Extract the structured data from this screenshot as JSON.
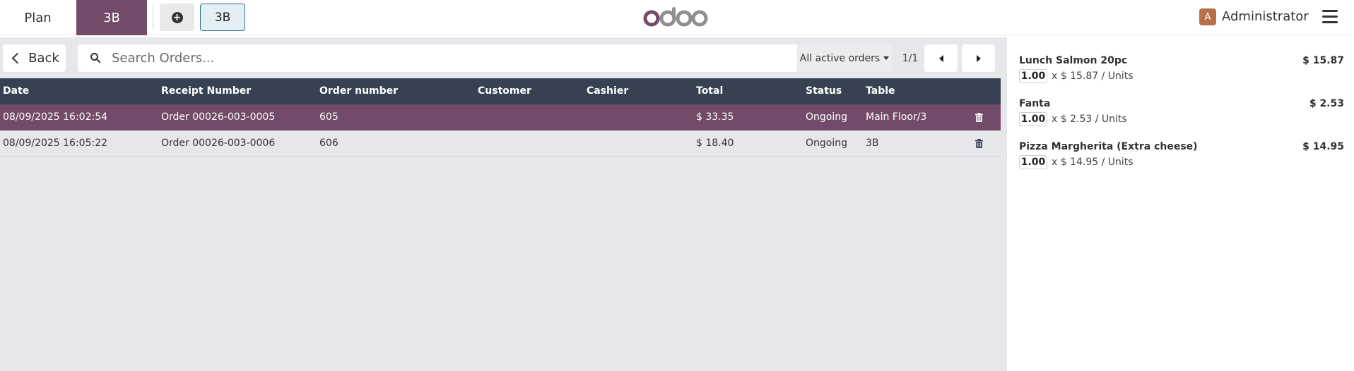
{
  "topbar": {
    "plan_label": "Plan",
    "active_table_label": "3B",
    "table_chip_label": "3B",
    "brand": "odoo",
    "user_initial": "A",
    "user_name": "Administrator",
    "accent_color": "#714b67"
  },
  "orders_panel": {
    "back_label": "Back",
    "search_placeholder": "Search Orders...",
    "filter_label": "All active orders",
    "pager_text": "1/1",
    "columns": [
      "Date",
      "Receipt Number",
      "Order number",
      "Customer",
      "Cashier",
      "Total",
      "Status",
      "Table"
    ],
    "rows": [
      {
        "date": "08/09/2025 16:02:54",
        "receipt": "Order 00026-003-0005",
        "order_number": "605",
        "customer": "",
        "cashier": "",
        "total": "$ 33.35",
        "status": "Ongoing",
        "table": "Main Floor/3",
        "selected": true
      },
      {
        "date": "08/09/2025 16:05:22",
        "receipt": "Order 00026-003-0006",
        "order_number": "606",
        "customer": "",
        "cashier": "",
        "total": "$ 18.40",
        "status": "Ongoing",
        "table": "3B",
        "selected": false
      }
    ]
  },
  "order_lines": [
    {
      "name": "Lunch Salmon 20pc",
      "price": "$ 15.87",
      "qty": "1.00",
      "unit_text": "x $ 15.87 / Units"
    },
    {
      "name": "Fanta",
      "price": "$ 2.53",
      "qty": "1.00",
      "unit_text": "x $ 2.53 / Units"
    },
    {
      "name": "Pizza Margherita (Extra cheese)",
      "price": "$ 14.95",
      "qty": "1.00",
      "unit_text": "x $ 14.95 / Units"
    }
  ]
}
